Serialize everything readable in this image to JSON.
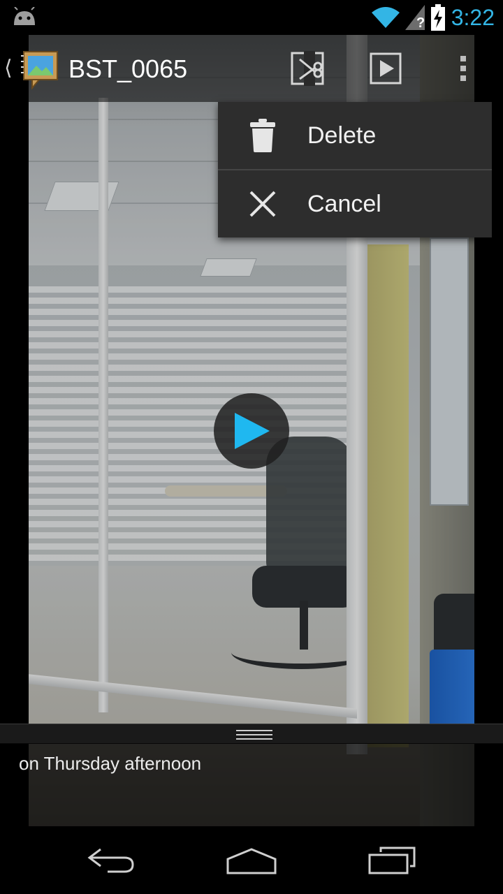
{
  "status_bar": {
    "time": "3:22",
    "icons": [
      "android-notification-icon",
      "wifi-icon",
      "no-signal-icon",
      "battery-charging-icon"
    ],
    "clock_color": "#33b5e5"
  },
  "action_bar": {
    "title": "BST_0065",
    "icons": [
      "up-caret-icon",
      "gallery-app-icon",
      "trim-icon",
      "play-slideshow-icon",
      "overflow-menu-icon"
    ]
  },
  "menu": {
    "items": [
      {
        "label": "Delete",
        "icon": "trash-icon"
      },
      {
        "label": "Cancel",
        "icon": "close-icon"
      }
    ]
  },
  "video": {
    "play_icon": "play-icon",
    "accent": "#1fb8f0"
  },
  "details": {
    "text": "on Thursday afternoon"
  },
  "nav_bar": {
    "icons": [
      "back-icon",
      "home-icon",
      "recent-apps-icon"
    ]
  }
}
